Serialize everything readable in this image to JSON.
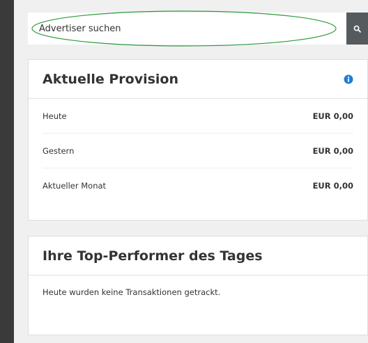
{
  "search": {
    "placeholder": "Advertiser suchen",
    "button_icon": "search-icon"
  },
  "provision": {
    "title": "Aktuelle Provision",
    "info_icon": "info-icon",
    "rows": [
      {
        "label": "Heute",
        "value": "EUR 0,00"
      },
      {
        "label": "Gestern",
        "value": "EUR 0,00"
      },
      {
        "label": "Aktueller Monat",
        "value": "EUR 0,00"
      }
    ]
  },
  "top_performer": {
    "title": "Ihre Top-Performer des Tages",
    "message": "Heute wurden keine Transaktionen getrackt."
  },
  "colors": {
    "accent_blue": "#1e7fd6",
    "highlight_green": "#2a9a3a",
    "search_button": "#555a5f"
  }
}
